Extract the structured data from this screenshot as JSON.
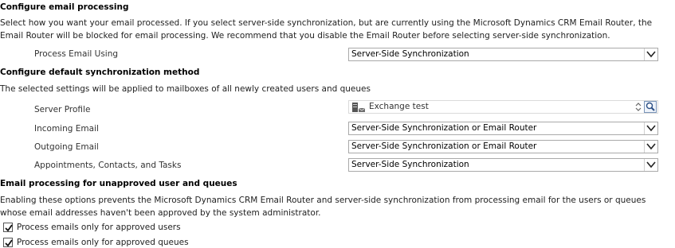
{
  "email_processing": {
    "title": "Configure email processing",
    "description": "Select how you want your email processed. If you select server-side synchronization, but are currently using the Microsoft Dynamics CRM Email Router, the Email Router will be blocked for email processing. We recommend that you disable the Email Router before selecting server-side synchronization.",
    "process_email_label": "Process Email Using",
    "process_email_value": "Server-Side Synchronization"
  },
  "sync_method": {
    "title": "Configure default synchronization method",
    "description": "The selected settings will be applied to mailboxes of all newly created users and queues",
    "server_profile_label": "Server Profile",
    "server_profile_value": "Exchange test",
    "incoming_label": "Incoming Email",
    "incoming_value": "Server-Side Synchronization or Email Router",
    "outgoing_label": "Outgoing Email",
    "outgoing_value": "Server-Side Synchronization or Email Router",
    "appointments_label": "Appointments, Contacts, and Tasks",
    "appointments_value": "Server-Side Synchronization"
  },
  "unapproved": {
    "title": "Email processing for unapproved user and queues",
    "description": "Enabling these options prevents the Microsoft Dynamics CRM Email Router and server-side synchronization from processing email for the users or queues whose email addresses haven't been approved by the system administrator.",
    "approved_users_label": "Process emails only for approved users",
    "approved_users_checked": true,
    "approved_queues_label": "Process emails only for approved queues",
    "approved_queues_checked": true
  },
  "icons": {
    "dropdown": "chevron-down-icon",
    "lookup": "magnifier-icon",
    "server_profile": "exchange-server-icon",
    "check": "checkmark-icon"
  }
}
